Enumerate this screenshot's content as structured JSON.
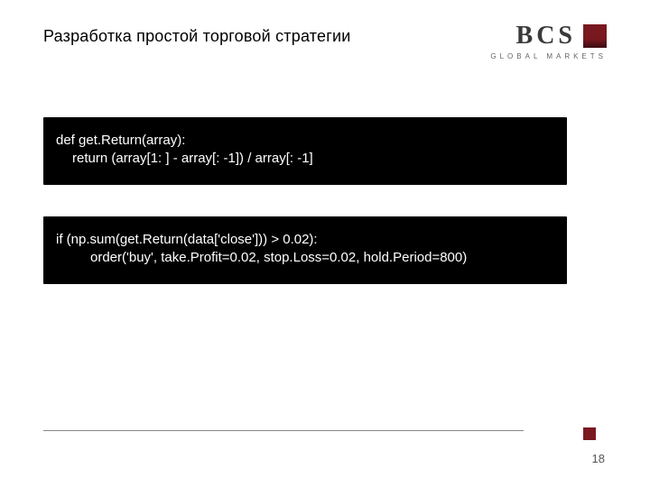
{
  "header": {
    "title": "Разработка простой торговой стратегии",
    "logo": {
      "letters": "BCS",
      "subtitle": "GLOBAL MARKETS"
    }
  },
  "code": {
    "block1": {
      "line1": "def get.Return(array):",
      "line2": "return (array[1: ] - array[: -1]) / array[: -1]"
    },
    "block2": {
      "line1": "if (np.sum(get.Return(data['close'])) > 0.02):",
      "line2": "order('buy', take.Profit=0.02, stop.Loss=0.02, hold.Period=800)"
    }
  },
  "footer": {
    "page_number": "18"
  }
}
